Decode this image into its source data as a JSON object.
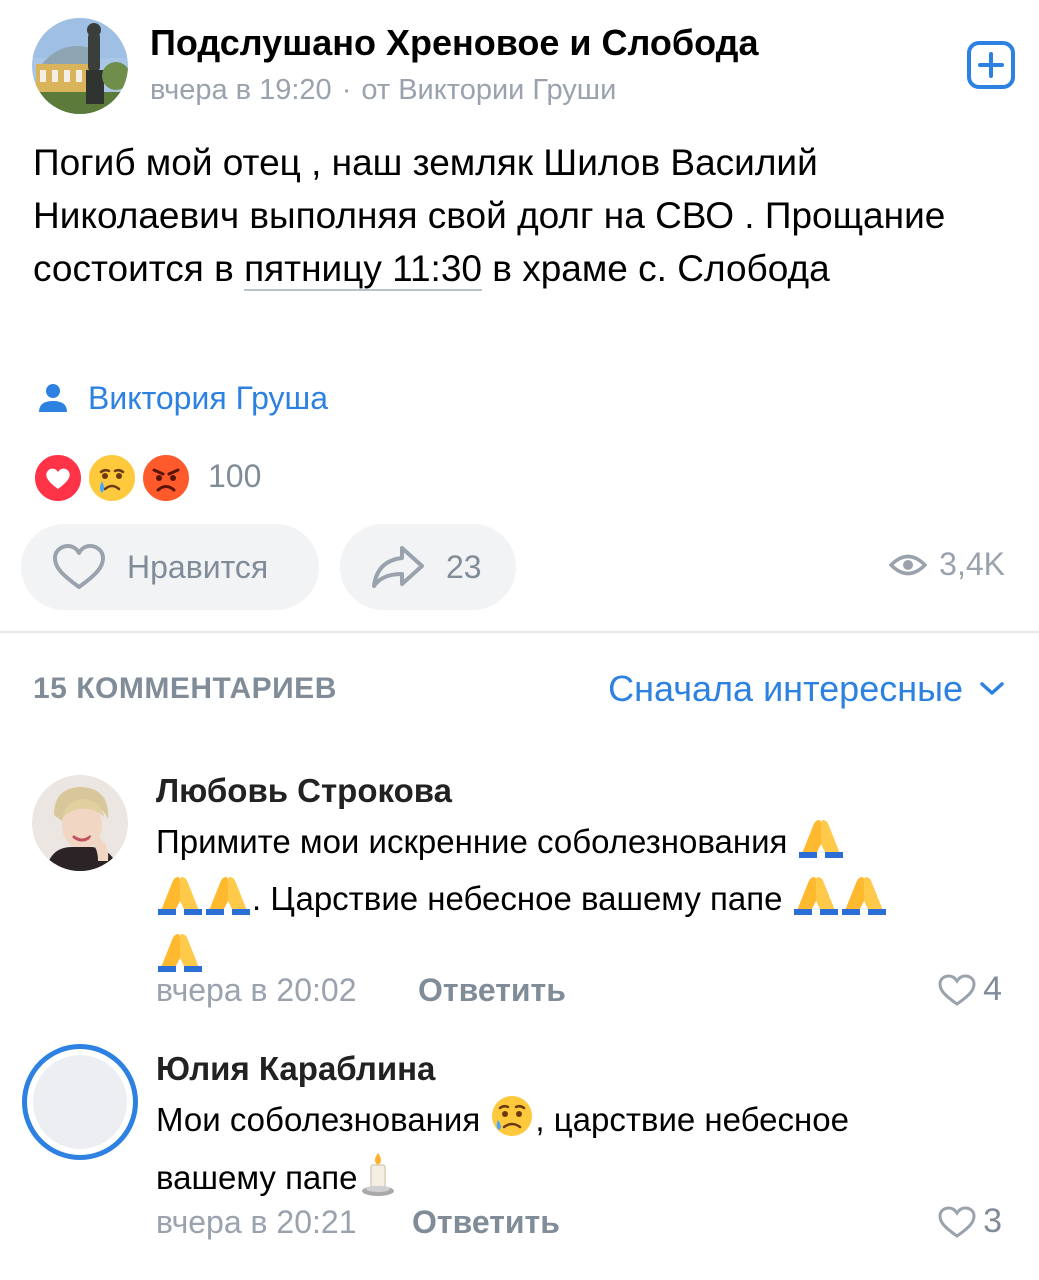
{
  "post": {
    "group_name": "Подслушано Хреновое и Слобода",
    "time": "вчера в 19:20",
    "separator": "·",
    "source": "от Виктории Груши",
    "text_part1": "Погиб мой отец , наш земляк Шилов Василий Николаевич выполняя свой долг на СВО . Прощание состоится в ",
    "text_link": "пятницу 11:30",
    "text_part2": " в храме с. Слобода",
    "author_sign": "Виктория Груша",
    "reactions": {
      "icons": [
        "heart-reaction",
        "crying-face-reaction",
        "angry-face-reaction"
      ],
      "count": "100"
    },
    "actions": {
      "like_label": "Нравится",
      "share_count": "23",
      "views": "3,4K"
    }
  },
  "comments_section": {
    "count_label": "15 КОММЕНТАРИЕВ",
    "sort_label": "Сначала интересные"
  },
  "comments": [
    {
      "author": "Любовь Строкова",
      "text_line1": "Примите мои искренние соболезнования ",
      "text_line2": ". Царствие небесное вашему папе ",
      "time": "вчера в 20:02",
      "reply_label": "Ответить",
      "likes": "4"
    },
    {
      "author": "Юлия Караблина",
      "text_line1": "Мои соболезнования ",
      "text_line1b": ", царствие небесное",
      "text_line2": "вашему папе",
      "time": "вчера в 20:21",
      "reply_label": "Ответить",
      "likes": "3"
    }
  ],
  "colors": {
    "accent": "#2d81e0",
    "secondary_text": "#99a2ad",
    "pill_bg": "#f2f3f5",
    "divider": "#e7e8ec"
  }
}
